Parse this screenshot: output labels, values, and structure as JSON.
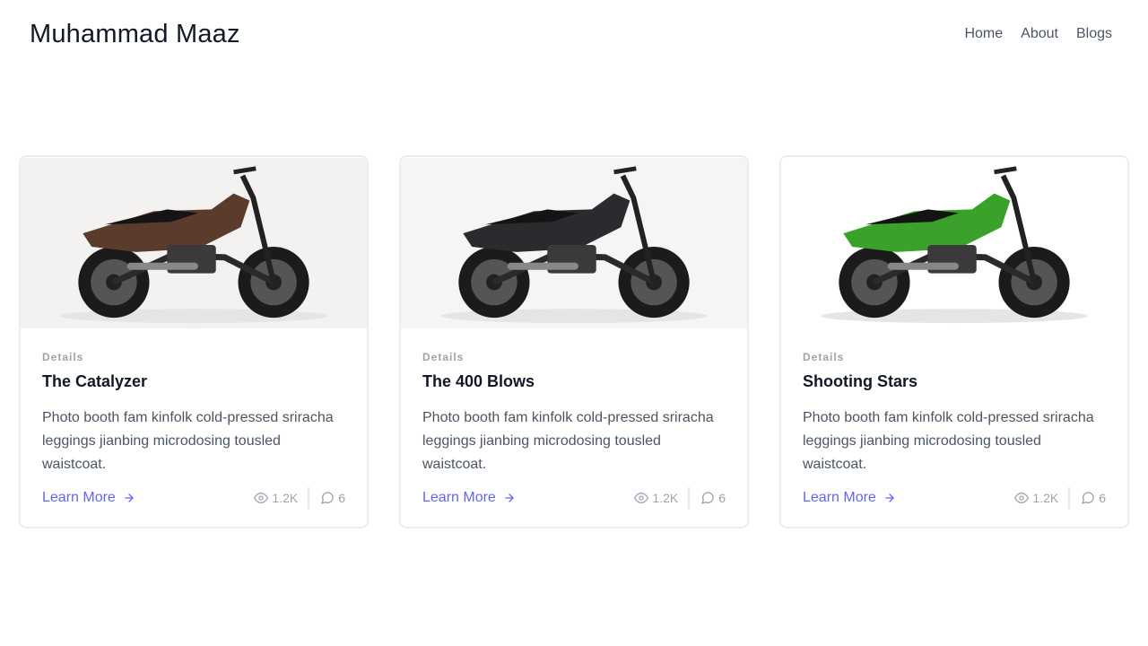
{
  "header": {
    "brand": "Muhammad Maaz",
    "nav": [
      "Home",
      "About",
      "Blogs"
    ]
  },
  "cards": [
    {
      "category": "Details",
      "title": "The Catalyzer",
      "description": "Photo booth fam kinfolk cold-pressed sriracha leggings jianbing microdosing tousled waistcoat.",
      "link": "Learn More",
      "views": "1.2K",
      "comments": "6",
      "bike_color": "#5a3b2c"
    },
    {
      "category": "Details",
      "title": "The 400 Blows",
      "description": "Photo booth fam kinfolk cold-pressed sriracha leggings jianbing microdosing tousled waistcoat.",
      "link": "Learn More",
      "views": "1.2K",
      "comments": "6",
      "bike_color": "#2b2b2f"
    },
    {
      "category": "Details",
      "title": "Shooting Stars",
      "description": "Photo booth fam kinfolk cold-pressed sriracha leggings jianbing microdosing tousled waistcoat.",
      "link": "Learn More",
      "views": "1.2K",
      "comments": "6",
      "bike_color": "#3aa12a"
    }
  ]
}
